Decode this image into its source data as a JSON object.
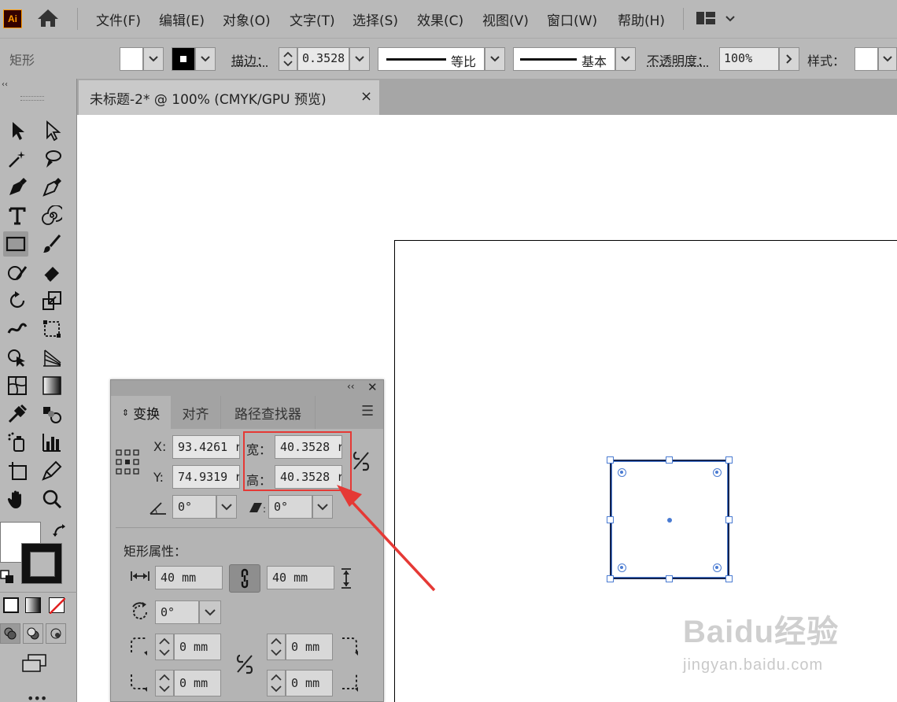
{
  "menubar": {
    "app_logo": "Ai",
    "items": [
      "文件(F)",
      "编辑(E)",
      "对象(O)",
      "文字(T)",
      "选择(S)",
      "效果(C)",
      "视图(V)",
      "窗口(W)",
      "帮助(H)"
    ]
  },
  "controlbar": {
    "object_type": "矩形",
    "stroke_label": "描边：",
    "stroke_weight": "0.3528",
    "stroke_profile": "等比",
    "brush": "基本",
    "opacity_label": "不透明度：",
    "opacity_value": "100%",
    "style_label": "样式："
  },
  "document_tab": {
    "title": "未标题-2* @ 100% (CMYK/GPU 预览)",
    "close": "×"
  },
  "panel": {
    "tabs": [
      "变换",
      "对齐",
      "路径查找器"
    ],
    "x_label": "X:",
    "x_value": "93.4261 r",
    "y_label": "Y:",
    "y_value": "74.9319 r",
    "width_label": "宽：",
    "width_value": "40.3528 r",
    "height_label": "高：",
    "height_value": "40.3528 r",
    "rotate_value": "0°",
    "shear_value": "0°",
    "rect_props_title": "矩形属性：",
    "rect_width": "40 mm",
    "rect_height": "40 mm",
    "rect_rotation": "0°",
    "corner_tl": "0 mm",
    "corner_tr": "0 mm",
    "corner_bl": "0 mm",
    "corner_br": "0 mm"
  },
  "watermark": {
    "brand": "Baidu经验",
    "url": "jingyan.baidu.com"
  },
  "colors": {
    "highlight": "#e53935",
    "selection": "#4a7bd2",
    "ai_logo": "#ff9a00"
  }
}
